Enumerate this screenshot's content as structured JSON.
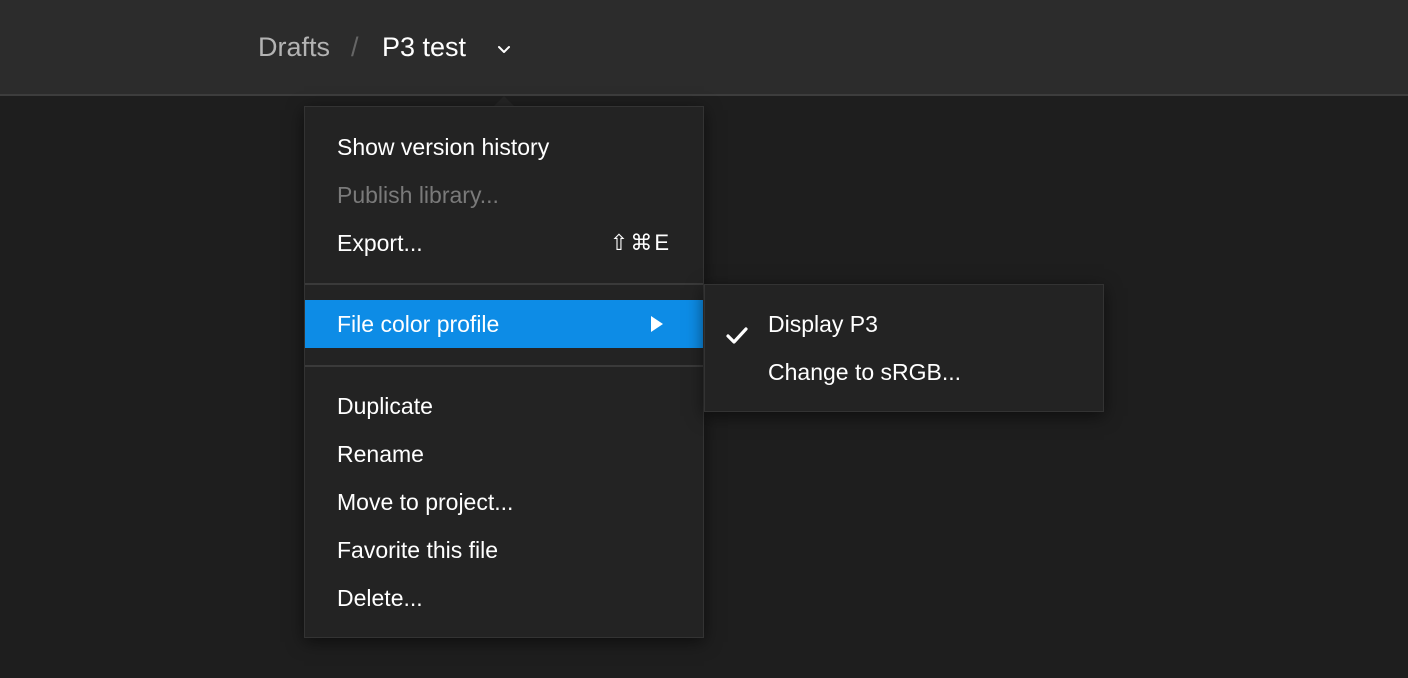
{
  "breadcrumb": {
    "root": "Drafts",
    "separator": "/",
    "file": "P3 test"
  },
  "menu": {
    "items": [
      {
        "label": "Show version history",
        "enabled": true
      },
      {
        "label": "Publish library...",
        "enabled": false
      },
      {
        "label": "Export...",
        "enabled": true,
        "shortcut": "⇧⌘E"
      },
      {
        "label": "File color profile",
        "enabled": true,
        "highlighted": true,
        "has_submenu": true
      },
      {
        "label": "Duplicate",
        "enabled": true
      },
      {
        "label": "Rename",
        "enabled": true
      },
      {
        "label": "Move to project...",
        "enabled": true
      },
      {
        "label": "Favorite this file",
        "enabled": true
      },
      {
        "label": "Delete...",
        "enabled": true
      }
    ]
  },
  "submenu": {
    "items": [
      {
        "label": "Display P3",
        "checked": true
      },
      {
        "label": "Change to sRGB...",
        "checked": false
      }
    ]
  },
  "colors": {
    "highlight": "#0d8ce6",
    "background": "#1e1e1e",
    "topbar": "#2c2c2c",
    "menu_bg": "#232323",
    "disabled_text": "#7a7a7a"
  },
  "icons": {
    "chevron": "chevron-down-icon",
    "submenu_arrow": "triangle-right-icon",
    "check": "checkmark-icon"
  }
}
